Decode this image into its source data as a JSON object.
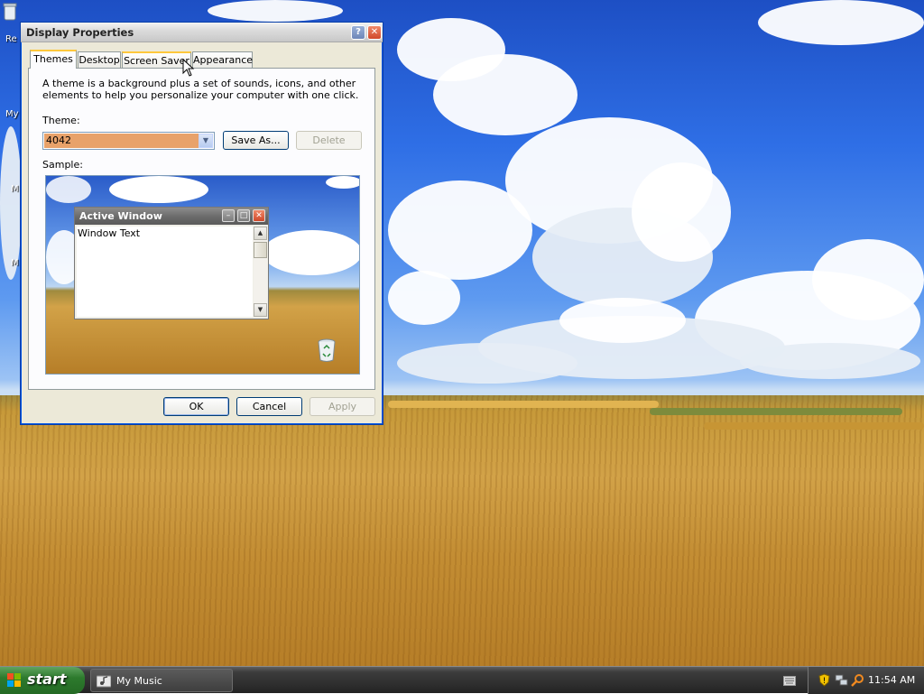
{
  "window": {
    "title": "Display Properties",
    "help_glyph": "?",
    "close_glyph": "✕"
  },
  "tabs": [
    {
      "label": "Themes",
      "active": true
    },
    {
      "label": "Desktop",
      "active": false
    },
    {
      "label": "Screen Saver",
      "active": false
    },
    {
      "label": "Appearance",
      "active": false
    }
  ],
  "themes": {
    "description": "A theme is a background plus a set of sounds, icons, and other elements to help you personalize your computer with one click.",
    "theme_label": "Theme:",
    "theme_value": "4042",
    "save_as_label": "Save As...",
    "delete_label": "Delete",
    "sample_label": "Sample:"
  },
  "sample": {
    "window_title": "Active Window",
    "window_text": "Window Text"
  },
  "dialog_buttons": {
    "ok": "OK",
    "cancel": "Cancel",
    "apply": "Apply"
  },
  "desktop_icons": [
    {
      "label": "Re"
    },
    {
      "label": "My"
    },
    {
      "label": "M"
    },
    {
      "label": "M"
    }
  ],
  "taskbar": {
    "start_label": "start",
    "items": [
      {
        "label": "My Music"
      }
    ],
    "clock": "11:54 AM"
  }
}
